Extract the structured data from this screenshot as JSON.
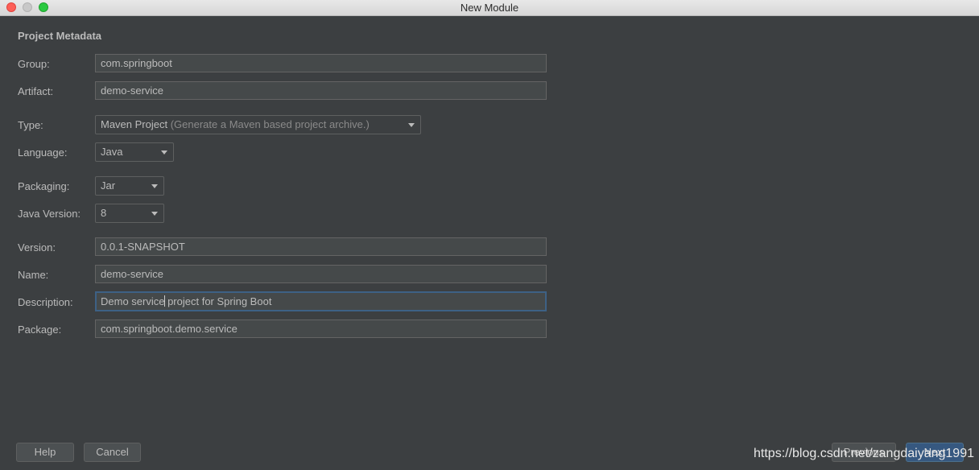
{
  "window": {
    "title": "New Module"
  },
  "section": {
    "title": "Project Metadata"
  },
  "fields": {
    "group": {
      "label": "Group:",
      "value": "com.springboot"
    },
    "artifact": {
      "label": "Artifact:",
      "value": "demo-service"
    },
    "type": {
      "label": "Type:",
      "value": "Maven Project",
      "hint": "(Generate a Maven based project archive.)"
    },
    "language": {
      "label": "Language:",
      "value": "Java"
    },
    "packaging": {
      "label": "Packaging:",
      "value": "Jar"
    },
    "java_version": {
      "label": "Java Version:",
      "value": "8"
    },
    "version": {
      "label": "Version:",
      "value": "0.0.1-SNAPSHOT"
    },
    "name": {
      "label": "Name:",
      "value": "demo-service"
    },
    "description": {
      "label": "Description:",
      "value_before_caret": "Demo service",
      "value_after_caret": " project for Spring Boot"
    },
    "package": {
      "label": "Package:",
      "value": "com.springboot.demo.service"
    }
  },
  "buttons": {
    "help": "Help",
    "cancel": "Cancel",
    "previous": "Previous",
    "next": "Next"
  },
  "watermark": "https://blog.csdn.net/zangdaiyang1991",
  "colors": {
    "background": "#3c3f41",
    "field_background": "#45494a",
    "focus_border": "#3d6185",
    "primary_button": "#365880"
  }
}
